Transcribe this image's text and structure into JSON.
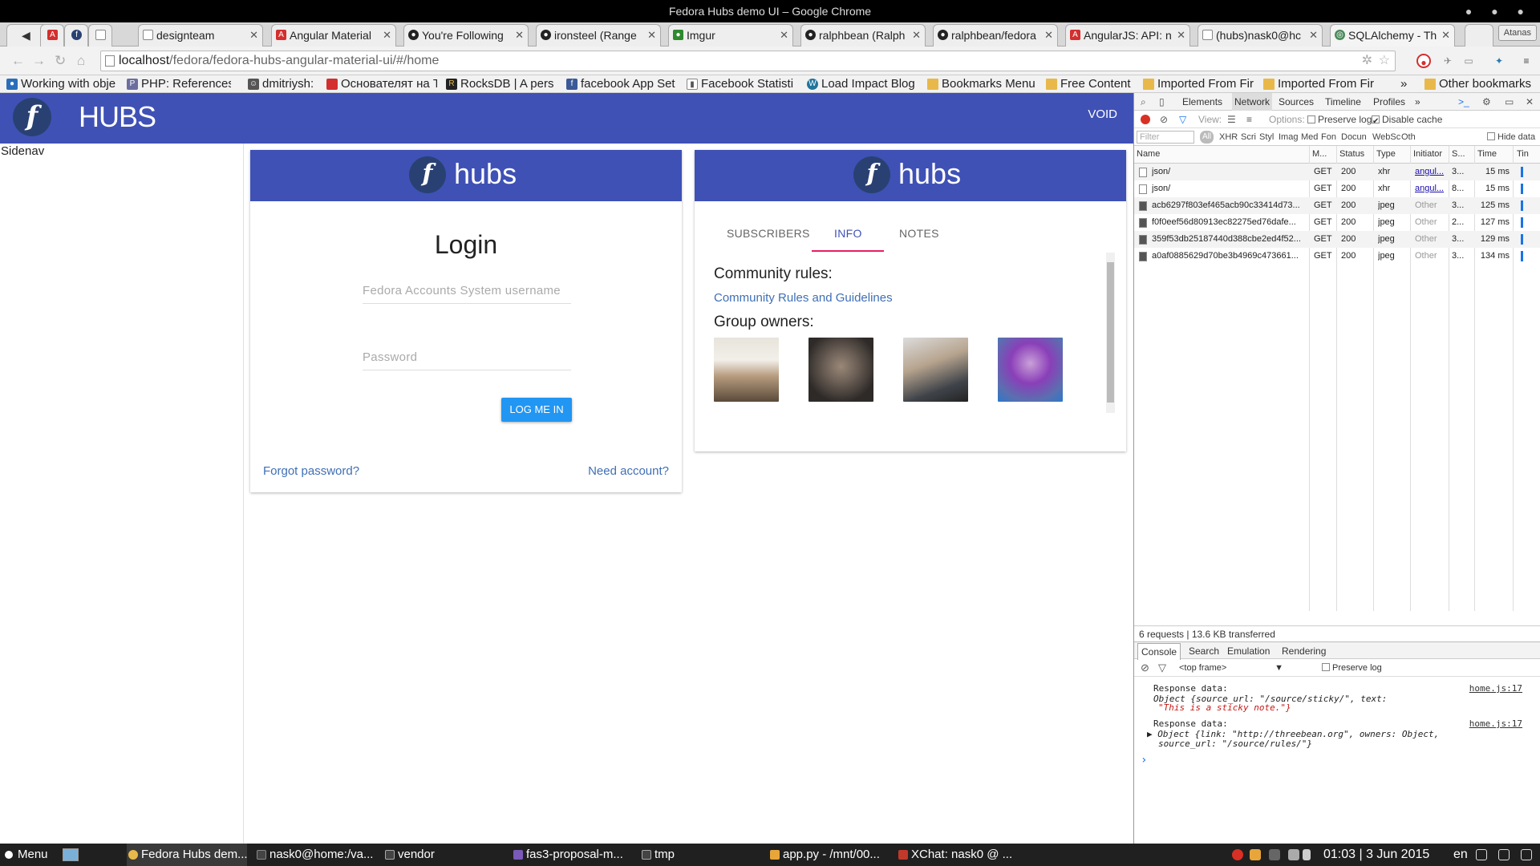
{
  "window": {
    "title": "Fedora Hubs demo UI – Google Chrome"
  },
  "tabs": [
    {
      "label": "designteam",
      "icon": "page-icon"
    },
    {
      "label": "Angular Material",
      "icon": "angular-icon"
    },
    {
      "label": "You're Following",
      "icon": "github-icon"
    },
    {
      "label": "ironsteel (Range",
      "icon": "github-icon"
    },
    {
      "label": "Imgur",
      "icon": "imgur-icon"
    },
    {
      "label": "ralphbean (Ralph",
      "icon": "github-icon"
    },
    {
      "label": "ralphbean/fedora",
      "icon": "github-icon"
    },
    {
      "label": "AngularJS: API: n",
      "icon": "angular-icon"
    },
    {
      "label": "(hubs)nask0@hc",
      "icon": "page-icon"
    },
    {
      "label": "SQLAlchemy - Th",
      "icon": "sqlalchemy-icon"
    }
  ],
  "profile_user": "Atanas",
  "address": {
    "host": "localhost",
    "path": "/fedora/fedora-hubs-angular-material-ui/#/home"
  },
  "bookmarks": [
    "Working with obje",
    "PHP: References",
    "dmitriysh:",
    "Основателят на Т",
    "RocksDB | A pers",
    "facebook App Set",
    "Facebook Statisti",
    "Load Impact Blog",
    "Bookmarks Menu",
    "Free Content",
    "Imported From Fir",
    "Imported From Fir"
  ],
  "bookmarks_more": "»",
  "other_bookmarks": "Other bookmarks",
  "app": {
    "logo_letter": "f",
    "name": "HUBS",
    "void_label": "VOID",
    "sidenav_label": "Sidenav"
  },
  "login": {
    "hubs_wordmark": "hubs",
    "title": "Login",
    "username_placeholder": "Fedora Accounts System username",
    "password_placeholder": "Password",
    "button": "LOG ME IN",
    "forgot": "Forgot password?",
    "need_account": "Need account?"
  },
  "info_card": {
    "hubs_wordmark": "hubs",
    "tabs": [
      "SUBSCRIBERS",
      "INFO",
      "NOTES"
    ],
    "active_tab": "INFO",
    "rules_heading": "Community rules:",
    "rules_link": "Community Rules and Guidelines",
    "owners_heading": "Group owners:"
  },
  "devtools": {
    "tabs": [
      "Elements",
      "Network",
      "Sources",
      "Timeline",
      "Profiles",
      "»"
    ],
    "active_tab": "Network",
    "view_label": "View:",
    "options_label": "Options:",
    "preserve_log": "Preserve log",
    "disable_cache": "Disable cache",
    "filter_placeholder": "Filter",
    "filter_types": [
      "All",
      "XHR",
      "Scri",
      "Styl",
      "Imag",
      "Med",
      "Fon",
      "Docun",
      "WebSc",
      "Oth"
    ],
    "hide_data": "Hide data",
    "columns": [
      "Name",
      "M...",
      "Status",
      "Type",
      "Initiator",
      "S...",
      "Time",
      "Tin"
    ],
    "requests": [
      {
        "name": "json/",
        "method": "GET",
        "status": "200",
        "type": "xhr",
        "initiator": "angul...",
        "size": "3...",
        "time": "15 ms"
      },
      {
        "name": "json/",
        "method": "GET",
        "status": "200",
        "type": "xhr",
        "initiator": "angul...",
        "size": "8...",
        "time": "15 ms"
      },
      {
        "name": "acb6297f803ef465acb90c33414d73...",
        "method": "GET",
        "status": "200",
        "type": "jpeg",
        "initiator": "Other",
        "size": "3...",
        "time": "125 ms"
      },
      {
        "name": "f0f0eef56d80913ec82275ed76dafe...",
        "method": "GET",
        "status": "200",
        "type": "jpeg",
        "initiator": "Other",
        "size": "2...",
        "time": "127 ms"
      },
      {
        "name": "359f53db25187440d388cbe2ed4f52...",
        "method": "GET",
        "status": "200",
        "type": "jpeg",
        "initiator": "Other",
        "size": "3...",
        "time": "129 ms"
      },
      {
        "name": "a0af0885629d70be3b4969c473661...",
        "method": "GET",
        "status": "200",
        "type": "jpeg",
        "initiator": "Other",
        "size": "3...",
        "time": "134 ms"
      }
    ],
    "summary": "6 requests  |  13.6 KB transferred",
    "drawer_tabs": [
      "Console",
      "Search",
      "Emulation",
      "Rendering"
    ],
    "frame": "<top frame>",
    "console_preserve": "Preserve log",
    "console": [
      {
        "label": "Response data:",
        "source": "home.js:17",
        "line1": "Object {source_url: \"/source/sticky/\", text:",
        "line2": "\"This is a sticky note.\"}"
      },
      {
        "label": "Response data:",
        "source": "home.js:17",
        "line1": "▶ Object {link: \"http://threebean.org\", owners: Object,",
        "line2": "source_url: \"/source/rules/\"}"
      }
    ],
    "prompt": "›"
  },
  "taskbar": {
    "menu": "Menu",
    "tasks": [
      "Fedora Hubs dem...",
      "nask0@home:/va...",
      "vendor",
      "fas3-proposal-m...",
      "tmp",
      "app.py - /mnt/00...",
      "XChat: nask0 @ ..."
    ],
    "clock": "01:03 | 3 Jun 2015",
    "lang": "en"
  }
}
